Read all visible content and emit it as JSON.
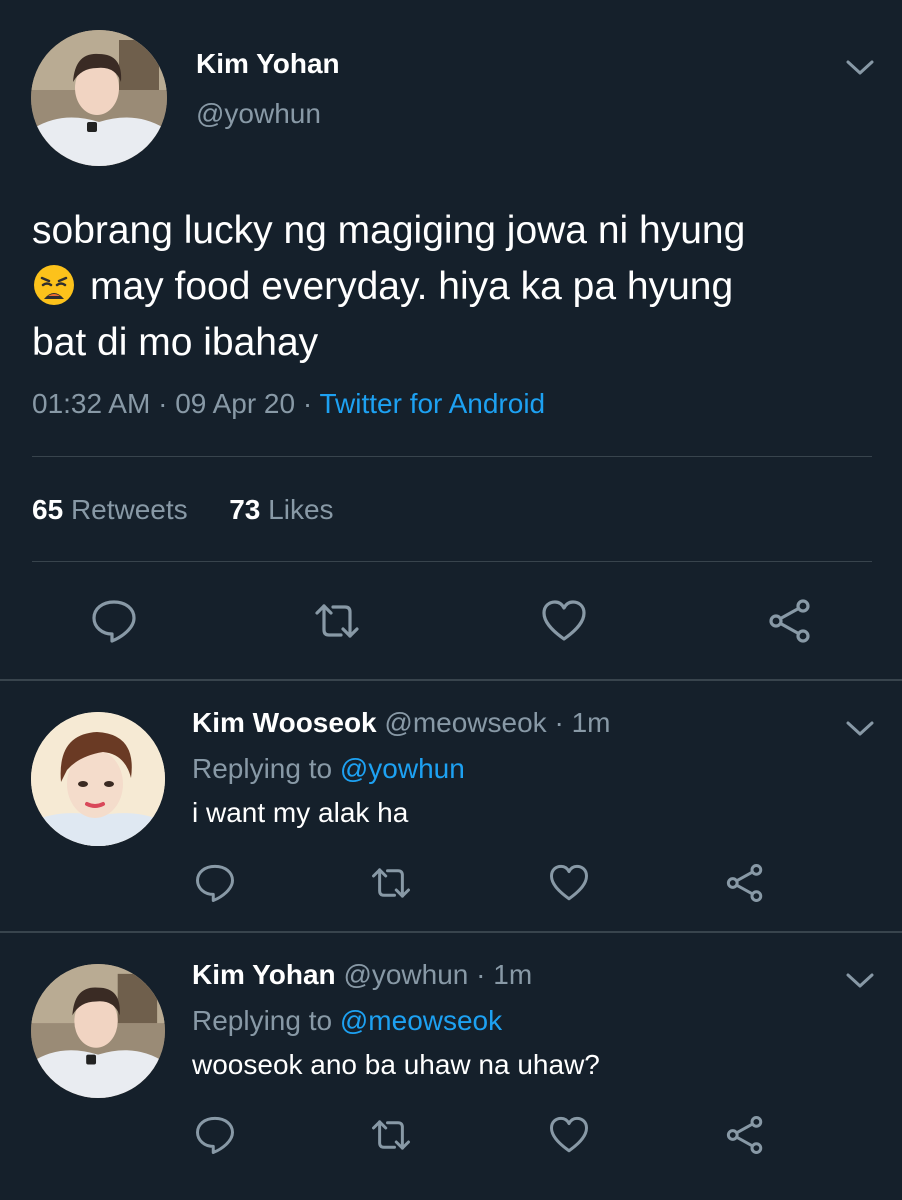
{
  "main_tweet": {
    "author_name": "Kim Yohan",
    "author_handle": "@yowhun",
    "text_line1": "sobrang lucky ng magiging jowa ni hyung",
    "text_line2": "may food everyday. hiya ka pa hyung",
    "text_line3": "bat di mo ibahay",
    "emoji": "weary-face",
    "time": "01:32 AM",
    "sep1": " · ",
    "date": "09 Apr 20",
    "sep2": " · ",
    "source": "Twitter for Android",
    "retweets_count": "65",
    "retweets_label": "Retweets",
    "likes_count": "73",
    "likes_label": "Likes"
  },
  "replies": [
    {
      "author_name": "Kim Wooseok",
      "author_handle": "@meowseok",
      "time_sep": " · ",
      "time": "1m",
      "replying_label": "Replying to ",
      "replying_to": "@yowhun",
      "text": "i want my alak ha"
    },
    {
      "author_name": "Kim Yohan",
      "author_handle": "@yowhun",
      "time_sep": " · ",
      "time": "1m",
      "replying_label": "Replying to ",
      "replying_to": "@meowseok",
      "text": "wooseok ano ba uhaw na uhaw?"
    }
  ],
  "icons": [
    "chevron-down-icon",
    "reply-icon",
    "retweet-icon",
    "like-icon",
    "share-icon"
  ],
  "colors": {
    "background": "#15202b",
    "primary_text": "#ffffff",
    "secondary_text": "#8899a6",
    "accent": "#1da1f2",
    "divider": "#38444d"
  }
}
